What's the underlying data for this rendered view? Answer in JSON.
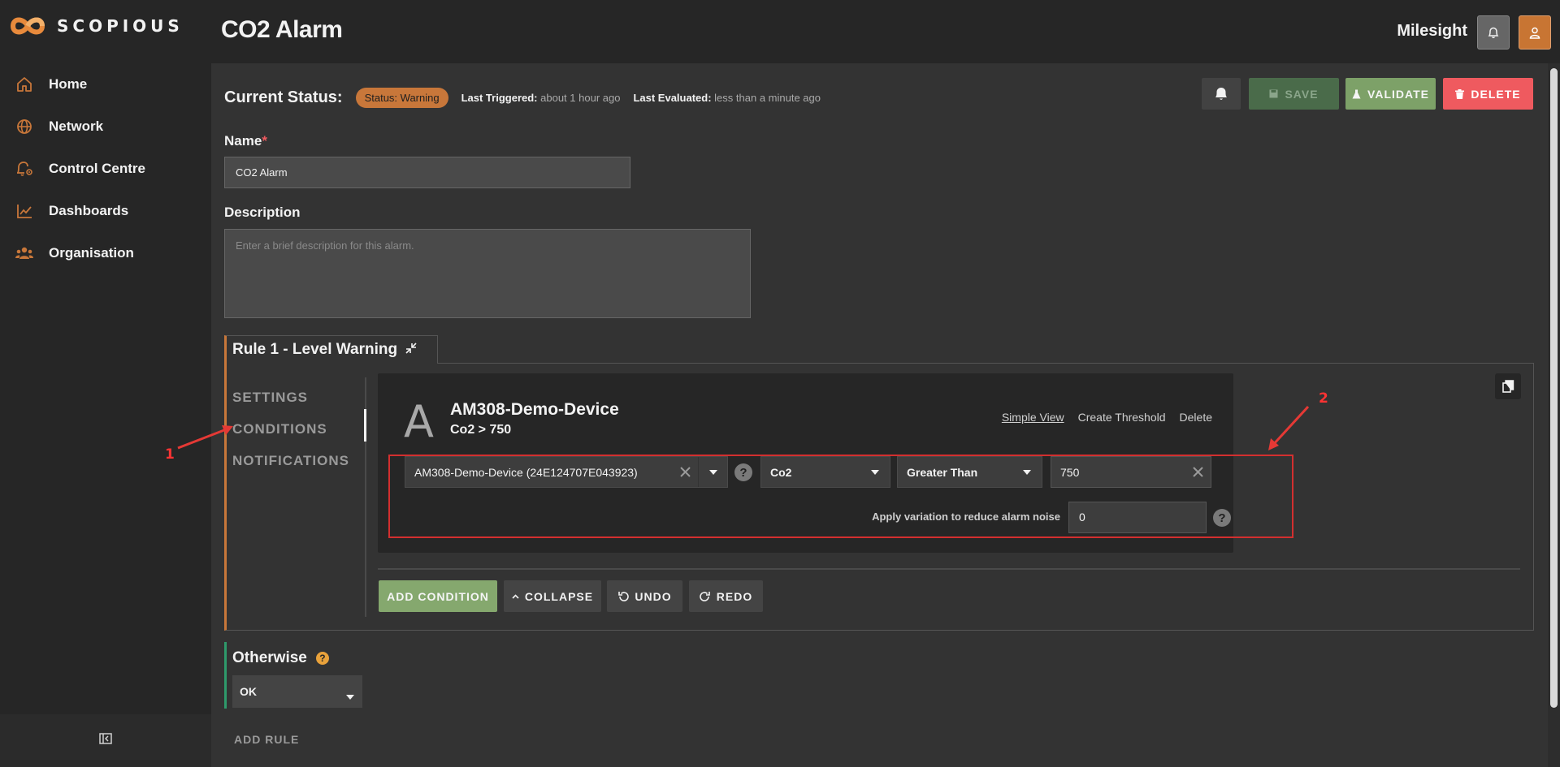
{
  "brand": {
    "name": "SCOPIOUS",
    "accent": "#c8773a"
  },
  "sidebar": {
    "items": [
      {
        "label": "Home",
        "icon": "home-icon"
      },
      {
        "label": "Network",
        "icon": "globe-icon"
      },
      {
        "label": "Control Centre",
        "icon": "bell-gear-icon"
      },
      {
        "label": "Dashboards",
        "icon": "line-chart-icon"
      },
      {
        "label": "Organisation",
        "icon": "users-icon"
      }
    ],
    "collapse_icon": "collapse-sidebar-icon"
  },
  "header": {
    "title": "CO2 Alarm",
    "org": "Milesight"
  },
  "status": {
    "label": "Current Status:",
    "badge": "Status: Warning",
    "last_triggered_label": "Last Triggered:",
    "last_triggered_value": "about 1 hour ago",
    "last_evaluated_label": "Last Evaluated:",
    "last_evaluated_value": "less than a minute ago"
  },
  "actions": {
    "save": "SAVE",
    "validate": "VALIDATE",
    "delete": "DELETE"
  },
  "form": {
    "name_label": "Name",
    "name_required": "*",
    "name_value": "CO2 Alarm",
    "description_label": "Description",
    "description_placeholder": "Enter a brief description for this alarm."
  },
  "rule": {
    "title": "Rule 1 - Level Warning",
    "tabs": [
      "SETTINGS",
      "CONDITIONS",
      "NOTIFICATIONS"
    ],
    "active_tab": "CONDITIONS",
    "condition": {
      "letter": "A",
      "device": "AM308-Demo-Device",
      "expression": "Co2 > 750",
      "links": {
        "simple_view": "Simple View",
        "create_threshold": "Create Threshold",
        "delete": "Delete"
      },
      "device_select": "AM308-Demo-Device (24E124707E043923)",
      "metric_select": "Co2",
      "operator_select": "Greater Than",
      "threshold_value": "750",
      "help": "?",
      "variation_label": "Apply variation to reduce alarm noise",
      "variation_value": "0"
    },
    "buttons": {
      "add_condition": "ADD CONDITION",
      "collapse": "COLLAPSE",
      "undo": "UNDO",
      "redo": "REDO"
    }
  },
  "otherwise": {
    "title": "Otherwise",
    "help": "?",
    "value": "OK"
  },
  "add_rule": "ADD RULE",
  "annotations": {
    "one": "1",
    "two": "2"
  }
}
